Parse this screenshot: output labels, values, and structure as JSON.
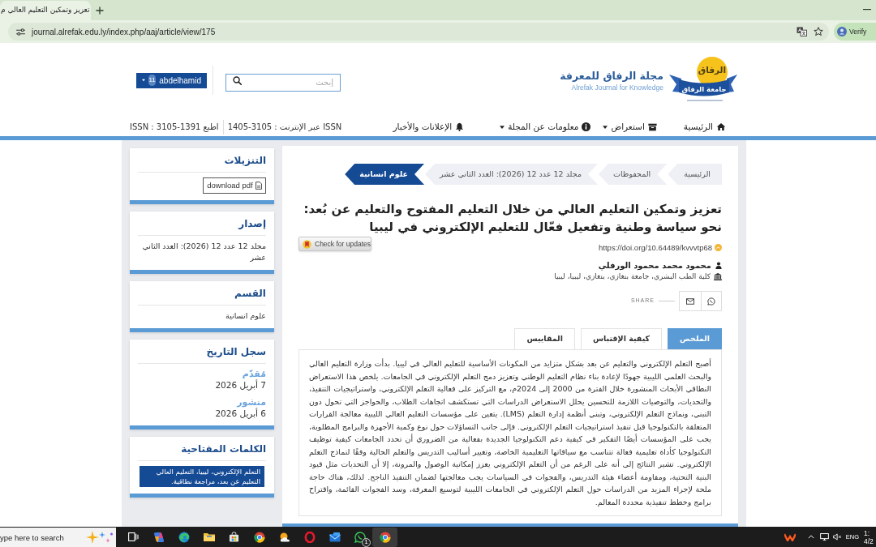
{
  "browser": {
    "tabs": [
      {
        "title": "تعزيز وتمكين التعليم العالي م",
        "selected": true
      }
    ],
    "url": "journal.alrefak.edu.ly/index.php/aaj/article/view/175",
    "profile": "Verify"
  },
  "header": {
    "logo": {
      "calligraphy": "الرفاق",
      "ribbon": "جامعة الرفاق"
    },
    "journal_title": "مجلة الرفاق للمعرفة",
    "journal_subtitle": "Alrefak Journal for Knowledge",
    "search": {
      "placeholder": "إبحث"
    },
    "user": {
      "badge": "11",
      "name": "abdelhamid"
    }
  },
  "nav": {
    "items": [
      {
        "label": "الرئيسية",
        "dropdown": false
      },
      {
        "label": "استعراض",
        "dropdown": true
      },
      {
        "label": "معلومات عن المجلة",
        "dropdown": true
      },
      {
        "label": "الإعلانات والأخبار",
        "dropdown": false
      }
    ],
    "issn": [
      "ISSN عبر الإنترنت : 3105-1405",
      "اطبع ISSN : 3105-1391"
    ]
  },
  "article": {
    "breadcrumb": [
      {
        "label": "الرئيسية",
        "selected": false
      },
      {
        "label": "المحفوظات",
        "selected": false
      },
      {
        "label": "مجلد 12 عدد 12 (2026): العدد الثاني عشر",
        "selected": false
      },
      {
        "label": "علوم انسانية",
        "selected": true
      }
    ],
    "title": "تعزيز وتمكين التعليم العالي من خلال التعليم المفتوح والتعليم عن بُعد: نحو سياسة وطنية وتفعيل فعّال للتعليم الإلكتروني في ليبيا",
    "doi": "https://doi.org/10.64489/kvvvtp68",
    "check_updates": "Check for updates",
    "author": {
      "name": "محمود محمد محمود الورفلي",
      "affiliation": "كلية الطب البشري، جامعة بنغازي، بنغازي، ليبيا، ليبيا"
    },
    "share": {
      "label": "SHARE"
    },
    "tabs": [
      {
        "label": "الملخص",
        "selected": true
      },
      {
        "label": "كيفية الإقتباس",
        "selected": false
      },
      {
        "label": "المقاييس",
        "selected": false
      }
    ],
    "abstract": "أصبح التعلم الإلكتروني والتعليم عن بعد بشكل متزايد من المكونات الأساسية للتعليم العالي في ليبيا. بدأت وزارة التعليم العالي والبحث العلمي الليبية جهودًا لإعادة بناء نظام التعليم الوطني وتعزيز دمج التعلم الإلكتروني في الجامعات. يلخص هذا الاستعراض النطاقي الأبحاث المنشورة خلال الفترة من 2000 إلى 2024م، مع التركيز على فعالية التعلم الإلكتروني، واستراتيجيات التنفيذ، والتحديات، والتوصيات اللازمة للتحسين يحلل الاستعراض الدراسات التي تستكشف اتجاهات الطلاب، والحواجز التي تحول دون التبني، ونماذج التعلم الإلكتروني، وتبني أنظمة إدارة التعلم (LMS). يتعين على مؤسسات التعليم العالي الليبية معالجة القرارات المتعلقة بالتكنولوجيا قبل تنفيذ استراتيجيات التعلم الإلكتروني. فإلى جانب التساؤلات حول نوع وكمية الأجهزة والبرامج المطلوبة، يجب على المؤسسات أيضًا التفكير في كيفية دعم التكنولوجيا الجديدة بفعالية من الضروري أن تحدد الجامعات كيفية توظيف التكنولوجيا كأداة تعليمية فعالة تتناسب مع سياقاتها التعليمية الخاصة، وتغيير أساليب التدريس والتعلم الحالية وفقًا لنماذج التعلم الإلكتروني. تشير النتائج إلى أنه على الرغم من أن التعلم الإلكتروني يعزز إمكانية الوصول والمرونة، إلا أن التحديات مثل قيود البنية التحتية، ومقاومة أعضاء هيئة التدريس، والفجوات في السياسات يجب معالجتها لضمان التنفيذ الناجح. لذلك، هناك حاجة ملحة لإجراء المزيد من الدراسات حول التعلم الإلكتروني في الجامعات الليبية لتوسيع المعرفة، وسد الفجوات القائمة، واقتراح برامج وخطط تنفيذية محددة المعالم."
  },
  "sidebar": [
    {
      "kind": "download",
      "title": "التنزيلات",
      "button": "download pdf"
    },
    {
      "kind": "text",
      "title": "إصدار",
      "text": "مجلد 12 عدد 12 (2026): العدد الثاني عشر"
    },
    {
      "kind": "text",
      "title": "القسم",
      "text": "علوم انسانية"
    },
    {
      "kind": "dates",
      "title": "سجل التاريخ",
      "dates": [
        {
          "label": "مُقدّم",
          "value": "7 أبريل 2026"
        },
        {
          "label": "منشور",
          "value": "6 أبريل 2026"
        }
      ]
    },
    {
      "kind": "keywords",
      "title": "الكلمات المفتاحية",
      "keywords": "التعلم الإلكتروني، ليبيا، التعليم العالي التعليم عن بعد، مراجعة نطاقية."
    }
  ],
  "taskbar": {
    "search": {
      "placeholder": "ype here to search"
    },
    "apps": [
      {
        "active": false
      },
      {
        "active": false
      },
      {
        "active": false
      },
      {
        "active": false
      },
      {
        "active": false
      },
      {
        "active": false
      },
      {
        "active": false
      },
      {
        "active": false
      },
      {
        "active": false
      },
      {
        "active": false,
        "badge": "1"
      },
      {
        "active": true
      }
    ],
    "tray": {
      "language": "ENG",
      "time": "1:",
      "date": "4/2"
    }
  }
}
